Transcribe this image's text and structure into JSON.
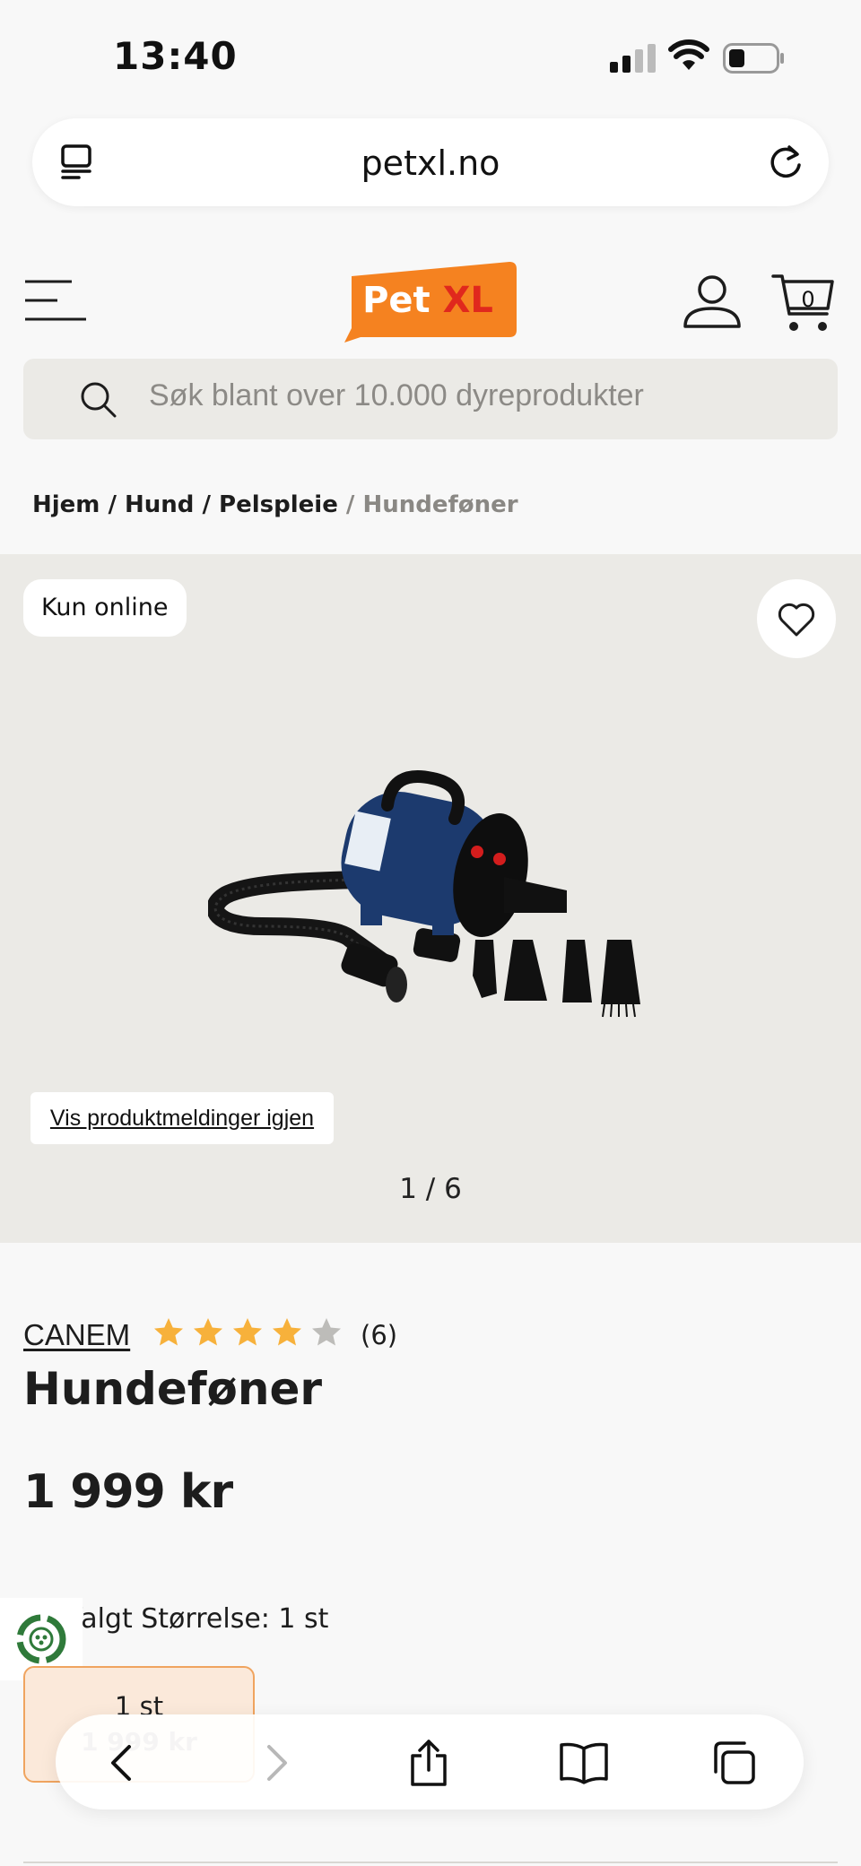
{
  "status_bar": {
    "time": "13:40"
  },
  "browser": {
    "url": "petxl.no"
  },
  "header": {
    "logo_pet": "Pet",
    "logo_xl": "XL",
    "cart_count": "0",
    "brand_color": "#f58220"
  },
  "search": {
    "placeholder": "Søk blant over 10.000 dyreprodukter"
  },
  "breadcrumb": {
    "items": [
      "Hjem",
      "Hund",
      "Pelspleie"
    ],
    "current": "Hundeføner",
    "separator": "/"
  },
  "gallery": {
    "badge": "Kun online",
    "show_notices_button": "Vis produktmeldinger igjen",
    "pager": "1 / 6"
  },
  "product": {
    "brand": "CANEM",
    "rating": 4,
    "rating_max": 5,
    "review_count": "(6)",
    "title": "Hundeføner",
    "price": "1 999 kr",
    "size_label": "Valgt Størrelse: 1 st",
    "size_options": [
      {
        "label": "1 st",
        "price": "1 999 kr"
      }
    ]
  },
  "colors": {
    "star_filled": "#f7b13b",
    "star_empty": "#bdbcb9",
    "gallery_bg": "#ebeae6",
    "selected_border": "#f0a45f"
  }
}
